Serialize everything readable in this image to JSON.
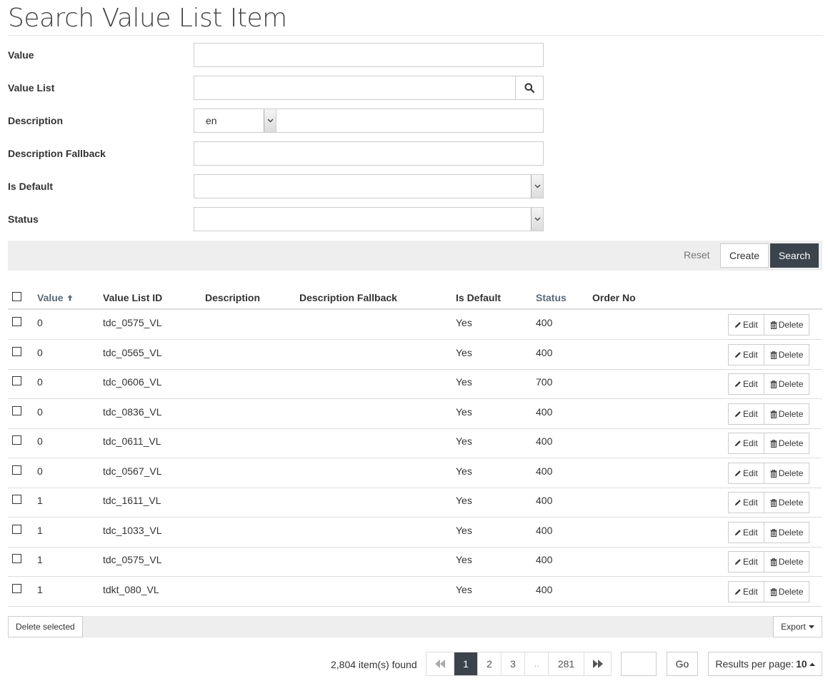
{
  "page": {
    "title": "Search Value List Item"
  },
  "form": {
    "value_label": "Value",
    "value_list_label": "Value List",
    "description_label": "Description",
    "description_lang": "en",
    "description_fallback_label": "Description Fallback",
    "is_default_label": "Is Default",
    "status_label": "Status"
  },
  "actions": {
    "reset": "Reset",
    "create": "Create",
    "search": "Search"
  },
  "table": {
    "headers": {
      "value": "Value",
      "value_list_id": "Value List ID",
      "description": "Description",
      "description_fallback": "Description Fallback",
      "is_default": "Is Default",
      "status": "Status",
      "order_no": "Order No"
    },
    "edit_label": "Edit",
    "delete_label": "Delete",
    "rows": [
      {
        "value": "0",
        "value_list_id": "tdc_0575_VL",
        "is_default": "Yes",
        "status": "400"
      },
      {
        "value": "0",
        "value_list_id": "tdc_0565_VL",
        "is_default": "Yes",
        "status": "400"
      },
      {
        "value": "0",
        "value_list_id": "tdc_0606_VL",
        "is_default": "Yes",
        "status": "700"
      },
      {
        "value": "0",
        "value_list_id": "tdc_0836_VL",
        "is_default": "Yes",
        "status": "400"
      },
      {
        "value": "0",
        "value_list_id": "tdc_0611_VL",
        "is_default": "Yes",
        "status": "400"
      },
      {
        "value": "0",
        "value_list_id": "tdc_0567_VL",
        "is_default": "Yes",
        "status": "400"
      },
      {
        "value": "1",
        "value_list_id": "tdc_1611_VL",
        "is_default": "Yes",
        "status": "400"
      },
      {
        "value": "1",
        "value_list_id": "tdc_1033_VL",
        "is_default": "Yes",
        "status": "400"
      },
      {
        "value": "1",
        "value_list_id": "tdc_0575_VL",
        "is_default": "Yes",
        "status": "400"
      },
      {
        "value": "1",
        "value_list_id": "tdkt_080_VL",
        "is_default": "Yes",
        "status": "400"
      }
    ]
  },
  "footer": {
    "delete_selected": "Delete selected",
    "export": "Export",
    "items_found": "2,804 item(s) found",
    "pages": [
      "1",
      "2",
      "3",
      "..",
      "281"
    ],
    "current_page": "1",
    "go": "Go",
    "results_per_page_label": "Results per page:",
    "results_per_page_value": "10"
  },
  "colors": {
    "primary_button": "#3b434c",
    "bar_background": "#eeeeee",
    "sort_header": "#5a6a78"
  }
}
